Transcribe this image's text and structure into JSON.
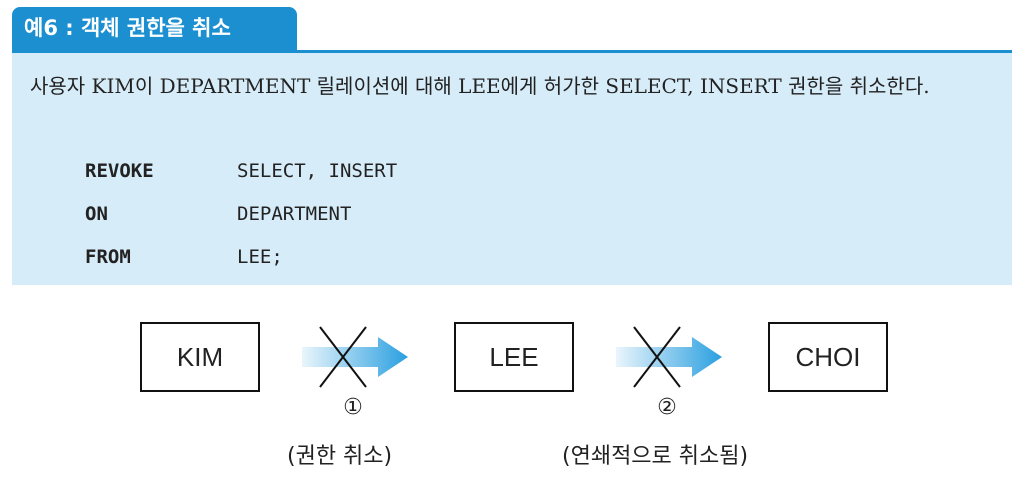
{
  "example": {
    "title": "예6 : 객체 권한을 취소",
    "description": "사용자 KIM이 DEPARTMENT 릴레이션에 대해 LEE에게 허가한 SELECT, INSERT 권한을 취소한다.",
    "code": [
      {
        "keyword": "REVOKE",
        "argument": "SELECT, INSERT"
      },
      {
        "keyword": "ON",
        "argument": "DEPARTMENT"
      },
      {
        "keyword": "FROM",
        "argument": "LEE;"
      }
    ]
  },
  "diagram": {
    "nodes": [
      "KIM",
      "LEE",
      "CHOI"
    ],
    "steps": [
      {
        "number": "①",
        "caption": "(권한 취소)"
      },
      {
        "number": "②",
        "caption": "(연쇄적으로 취소됨)"
      }
    ],
    "colors": {
      "accent": "#1c8fd0",
      "panel": "#d6ecf8",
      "arrow": "#2a9fe0"
    }
  }
}
